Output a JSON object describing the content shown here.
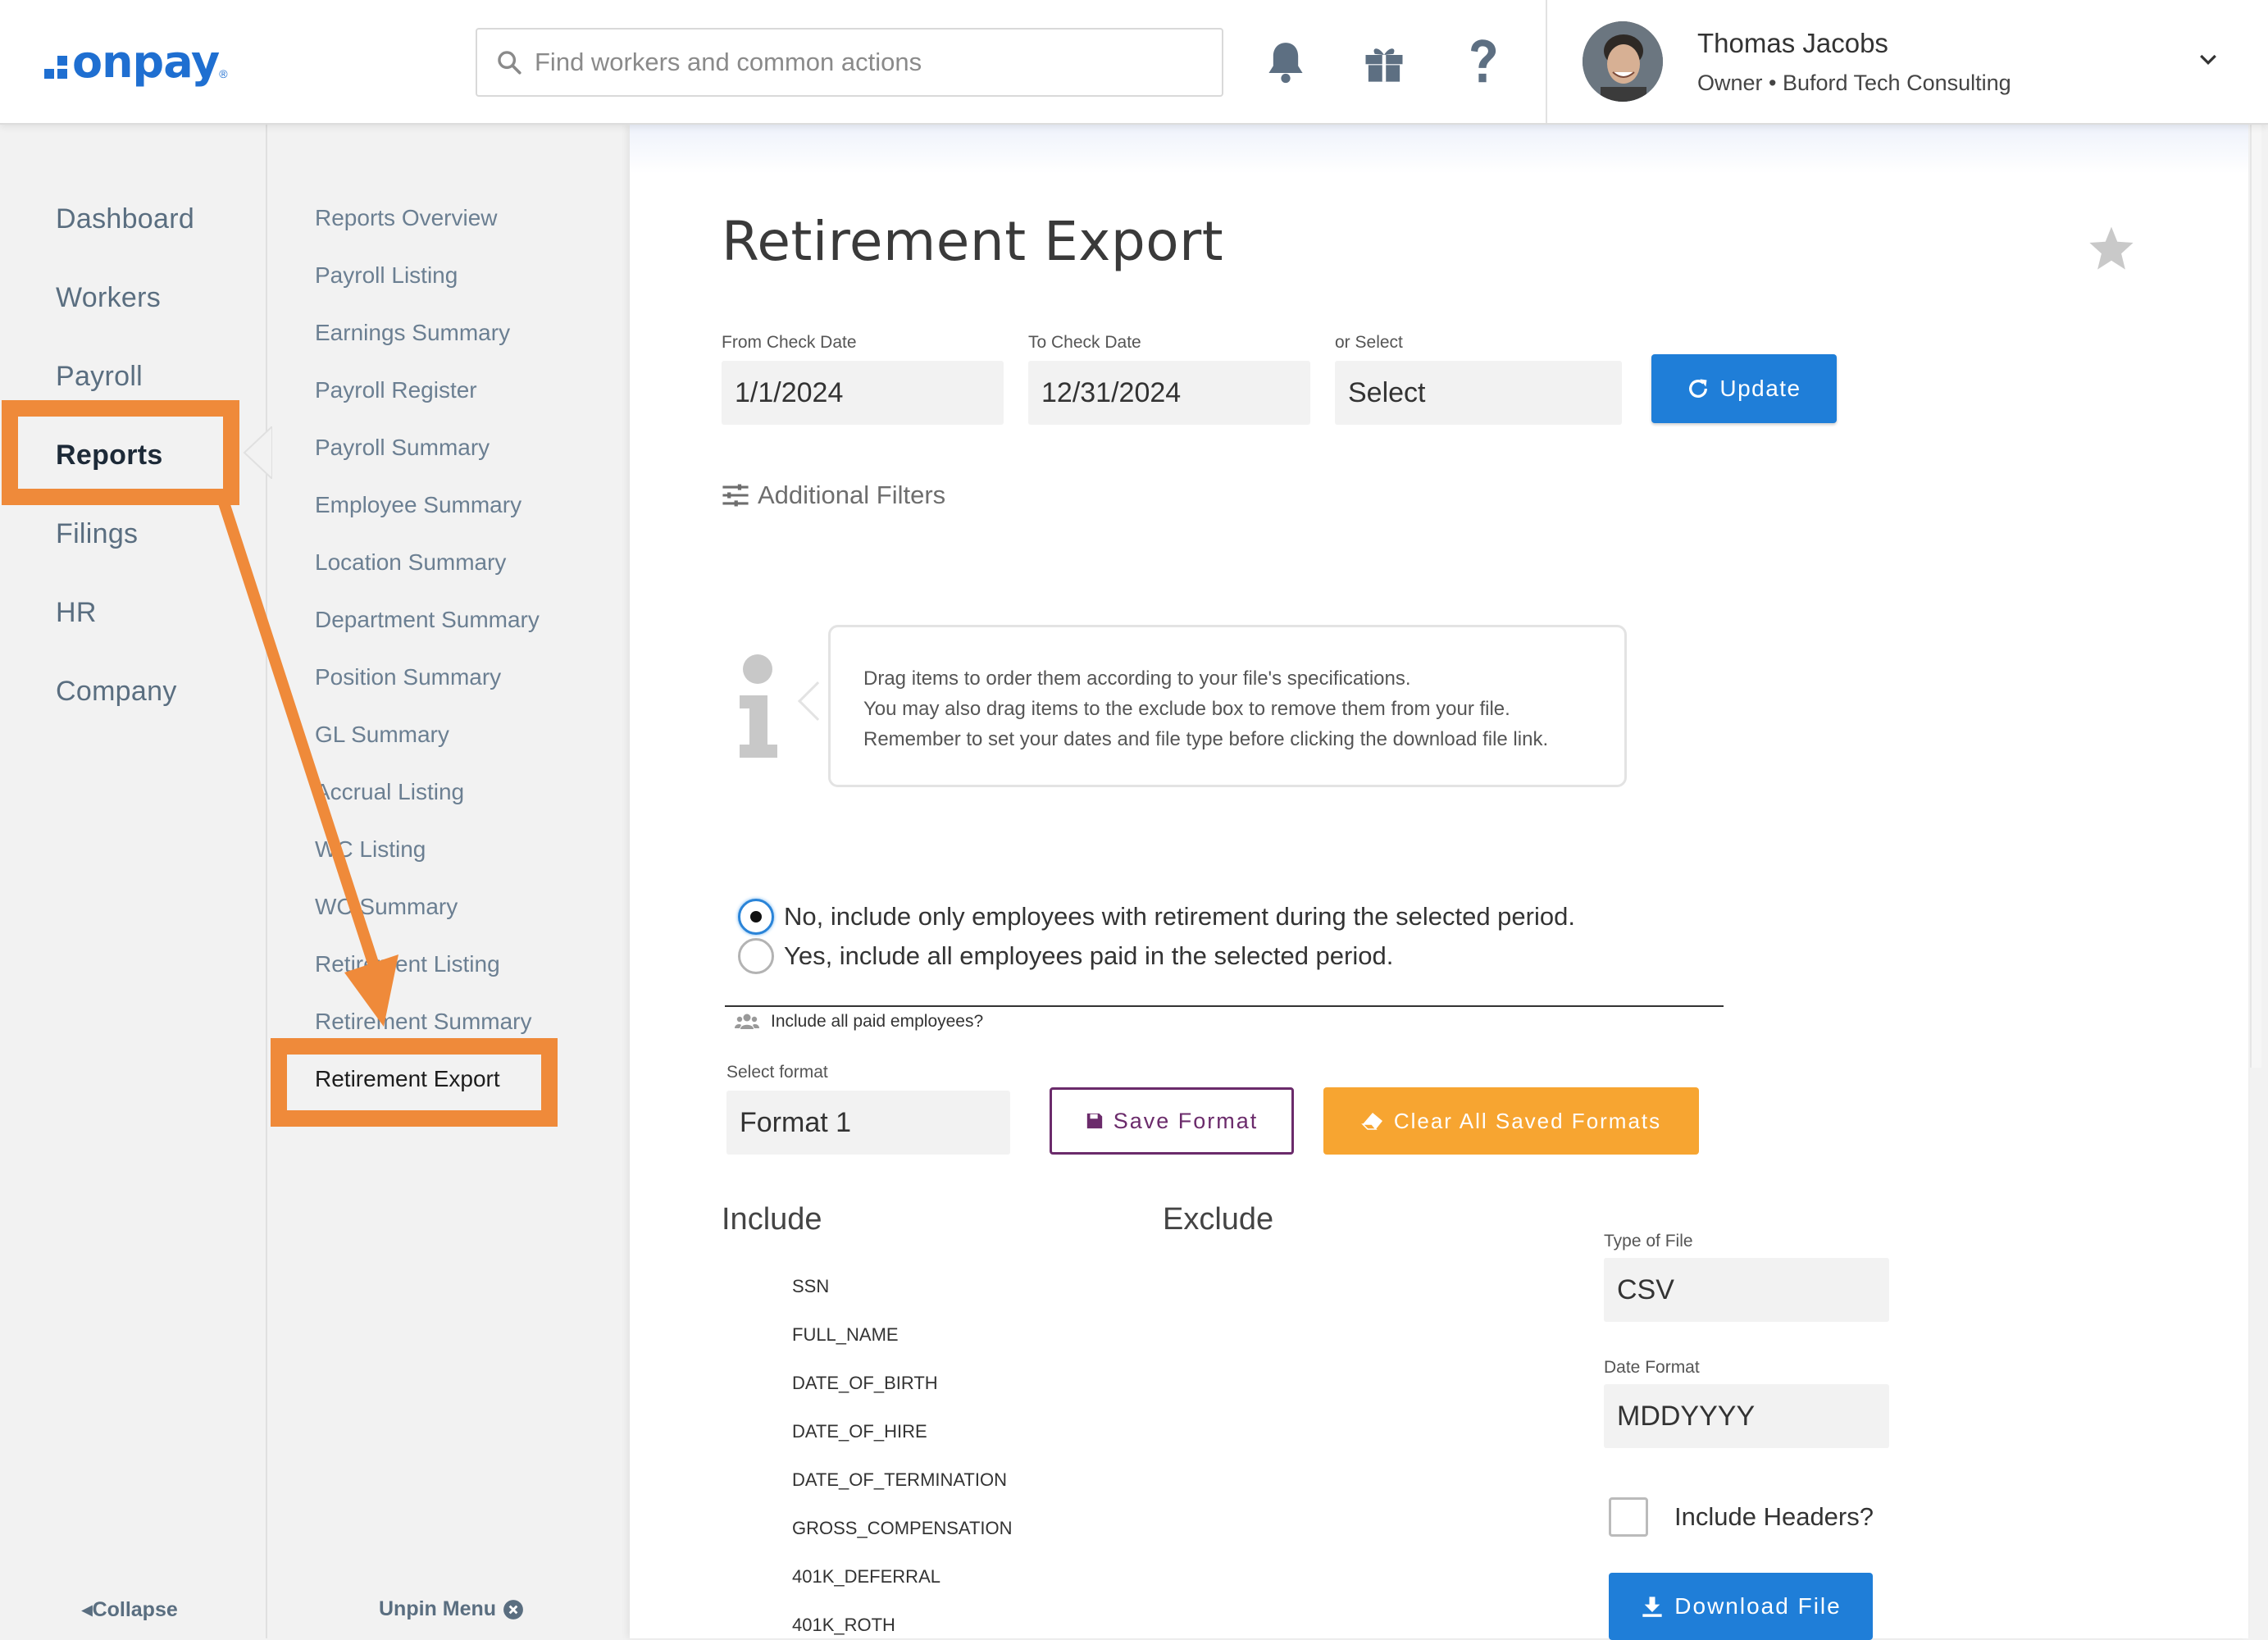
{
  "header": {
    "logo_text": "onpay",
    "logo_reg": "®",
    "search": {
      "placeholder": "Find workers and common actions"
    },
    "icons": [
      "bell-icon",
      "gift-icon",
      "help-icon"
    ],
    "user": {
      "name": "Thomas Jacobs",
      "role": "Owner • Buford Tech Consulting"
    }
  },
  "primary_nav": {
    "items": [
      "Dashboard",
      "Workers",
      "Payroll",
      "Reports",
      "Filings",
      "HR",
      "Company"
    ],
    "active": "Reports",
    "collapse_label": "Collapse"
  },
  "secondary_nav": {
    "items": [
      "Reports Overview",
      "Payroll Listing",
      "Earnings Summary",
      "Payroll Register",
      "Payroll Summary",
      "Employee Summary",
      "Location Summary",
      "Department Summary",
      "Position Summary",
      "GL Summary",
      "Accrual Listing",
      "WC Listing",
      "WC Summary",
      "Retirement Listing",
      "Retirement Summary",
      "Retirement Export"
    ],
    "active": "Retirement Export",
    "unpin_label": "Unpin Menu"
  },
  "page": {
    "title": "Retirement Export",
    "from_date": {
      "label": "From Check Date",
      "value": "1/1/2024"
    },
    "to_date": {
      "label": "To Check Date",
      "value": "12/31/2024"
    },
    "or_select": {
      "label": "or Select",
      "value": "Select"
    },
    "update_label": "Update",
    "additional_filters_label": "Additional Filters",
    "info_lines": [
      "Drag items to order them according to your file's specifications.",
      "You may also drag items to the exclude box to remove them from your file.",
      "Remember to set your dates and file type before clicking the download file link."
    ],
    "radio_options": [
      {
        "label": "No, include only employees with retirement during the selected period.",
        "checked": true
      },
      {
        "label": "Yes, include all employees paid in the selected period.",
        "checked": false
      }
    ],
    "include_paid_label": "Include all paid employees?",
    "select_format": {
      "label": "Select format",
      "value": "Format 1"
    },
    "save_format_label": "Save Format",
    "clear_formats_label": "Clear All Saved Formats",
    "include_heading": "Include",
    "exclude_heading": "Exclude",
    "include_items": [
      "SSN",
      "FULL_NAME",
      "DATE_OF_BIRTH",
      "DATE_OF_HIRE",
      "DATE_OF_TERMINATION",
      "GROSS_COMPENSATION",
      "401K_DEFERRAL",
      "401K_ROTH"
    ],
    "type_of_file": {
      "label": "Type of File",
      "value": "CSV"
    },
    "date_format": {
      "label": "Date Format",
      "value": "MDDYYYY"
    },
    "include_headers_label": "Include Headers?",
    "download_label": "Download File"
  },
  "colors": {
    "brand_blue": "#1f6fd1",
    "button_blue": "#1f7ed8",
    "save_purple": "#6b2b6b",
    "clear_orange": "#f7a531",
    "annotation_orange": "#ef8a3a"
  }
}
